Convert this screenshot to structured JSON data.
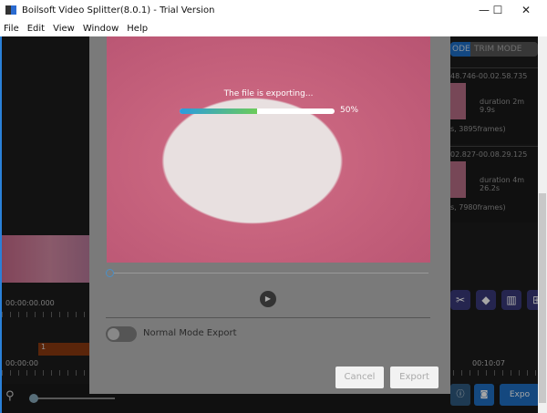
{
  "window": {
    "title": "Boilsoft Video Splitter(8.0.1) - Trial Version",
    "minimize": "—",
    "maximize": "☐",
    "close": "✕"
  },
  "menu": [
    "File",
    "Edit",
    "View",
    "Window",
    "Help"
  ],
  "timeline": {
    "tc_top": "00:00:00.000",
    "tc_bottom": "00:00:00",
    "tc_right": "00:10:07",
    "segment_label": "1"
  },
  "right_panel": {
    "mode_active": "ODE",
    "mode_inactive": "TRIM MODE",
    "clips": [
      {
        "range": "48.746-00.02.58.735",
        "duration": "duration 2m 9.9s",
        "frames": "s, 3895frames)"
      },
      {
        "range": "02.827-00.08.29.125",
        "duration": "duration 4m 26.2s",
        "frames": "s, 7980frames)"
      }
    ]
  },
  "dialog": {
    "status": "The file is exporting...",
    "progress_percent": 50,
    "progress_label": "50%",
    "toggle_label": "Normal Mode Export",
    "toggle_on": false,
    "cancel": "Cancel",
    "export": "Export"
  },
  "bottom": {
    "export_label": "Expo"
  },
  "colors": {
    "accent": "#1f6fc4",
    "progress_start": "#2a9be0",
    "progress_end": "#6ccb5a",
    "segment": "#8a3a10"
  }
}
